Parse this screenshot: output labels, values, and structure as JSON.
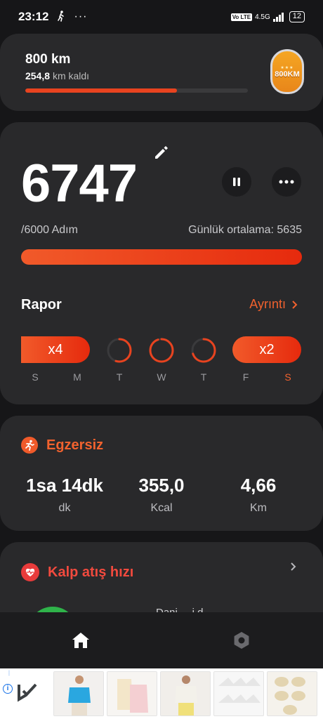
{
  "status_bar": {
    "time": "23:12",
    "network": "4.5G",
    "volte": "Vo LTE",
    "battery": "12"
  },
  "goal_card": {
    "title": "800 km",
    "remaining_value": "254,8",
    "remaining_suffix": "km kaldı",
    "progress": 0.68,
    "badge_text": "800KM"
  },
  "steps_card": {
    "count": "6747",
    "goal": "/6000 Adım",
    "daily_average": "Günlük ortalama: 5635",
    "progress": 1.0,
    "report_title": "Rapor",
    "details_link": "Ayrıntı",
    "week": [
      {
        "day": "S",
        "type": "pill",
        "label": "x4"
      },
      {
        "day": "M",
        "type": "pill",
        "label": ""
      },
      {
        "day": "T",
        "type": "ring",
        "progress": 0.55
      },
      {
        "day": "W",
        "type": "ring",
        "progress": 0.95
      },
      {
        "day": "T",
        "type": "ring",
        "progress": 0.7
      },
      {
        "day": "F",
        "type": "pill",
        "label": "x2"
      },
      {
        "day": "S",
        "type": "pill",
        "label": "",
        "today": true
      }
    ]
  },
  "exercise_card": {
    "title": "Egzersiz",
    "stats": [
      {
        "value": "1sa 14dk",
        "unit": "dk"
      },
      {
        "value": "355,0",
        "unit": "Kcal"
      },
      {
        "value": "4,66",
        "unit": "Km"
      }
    ]
  },
  "heart_card": {
    "title": "Kalp atış hızı",
    "partial_text": "Dani   ...   i   d"
  },
  "colors": {
    "accent": "#f2622e",
    "card": "#29292b",
    "background": "#161618",
    "heart": "#e83b3b",
    "heart_circle": "#2fb34a"
  },
  "icons": [
    "walking-icon",
    "edit-icon",
    "pause-icon",
    "more-icon",
    "chevron-right-icon",
    "running-icon",
    "heart-icon",
    "home-icon",
    "settings-icon",
    "ad-info-icon"
  ]
}
